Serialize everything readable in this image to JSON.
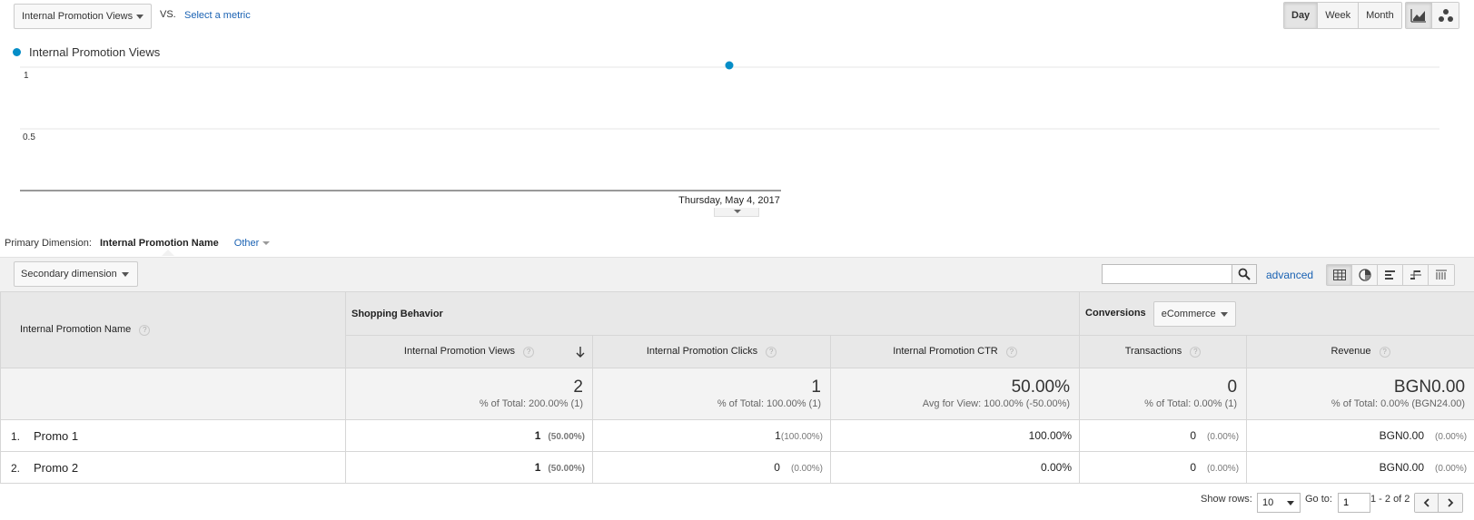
{
  "controls": {
    "metric": "Internal Promotion Views",
    "vs": "VS.",
    "select_metric": "Select a metric",
    "periods": [
      "Day",
      "Week",
      "Month"
    ],
    "active_period": "Day"
  },
  "colors": {
    "series": "#058dc7",
    "link": "#1a62b3"
  },
  "chart_data": {
    "type": "line",
    "x": [
      "Thursday, May 4, 2017"
    ],
    "series": [
      {
        "name": "Internal Promotion Views",
        "values": [
          1
        ]
      }
    ],
    "y_ticks": [
      "1",
      "0.5"
    ],
    "ylim": [
      0,
      1
    ],
    "grid": true,
    "legend": "top-left"
  },
  "primary_dimension": {
    "label": "Primary Dimension:",
    "active": "Internal Promotion Name",
    "other": "Other"
  },
  "toolbar": {
    "secondary_dimension": "Secondary dimension",
    "advanced": "advanced"
  },
  "table": {
    "dimension_header": "Internal Promotion Name",
    "group_shopping": "Shopping Behavior",
    "group_conversions": "Conversions",
    "conversions_select": "eCommerce",
    "columns": [
      "Internal Promotion Views",
      "Internal Promotion Clicks",
      "Internal Promotion CTR",
      "Transactions",
      "Revenue"
    ],
    "totals": [
      {
        "value": "2",
        "sub": "% of Total: 200.00% (1)"
      },
      {
        "value": "1",
        "sub": "% of Total: 100.00% (1)"
      },
      {
        "value": "50.00%",
        "sub": "Avg for View: 100.00% (-50.00%)"
      },
      {
        "value": "0",
        "sub": "% of Total: 0.00% (1)"
      },
      {
        "value": "BGN0.00",
        "sub": "% of Total: 0.00% (BGN24.00)"
      }
    ],
    "rows": [
      {
        "index": "1.",
        "name": "Promo 1",
        "views": "1",
        "views_pct": "(50.00%)",
        "clicks": "1",
        "clicks_pct": "(100.00%)",
        "ctr": "100.00%",
        "transactions": "0",
        "transactions_pct": "(0.00%)",
        "revenue": "BGN0.00",
        "revenue_pct": "(0.00%)"
      },
      {
        "index": "2.",
        "name": "Promo 2",
        "views": "1",
        "views_pct": "(50.00%)",
        "clicks": "0",
        "clicks_pct": "(0.00%)",
        "ctr": "0.00%",
        "transactions": "0",
        "transactions_pct": "(0.00%)",
        "revenue": "BGN0.00",
        "revenue_pct": "(0.00%)"
      }
    ]
  },
  "pagination": {
    "show_rows_label": "Show rows:",
    "rows": "10",
    "goto_label": "Go to:",
    "goto_value": "1",
    "range": "1 - 2 of 2"
  }
}
